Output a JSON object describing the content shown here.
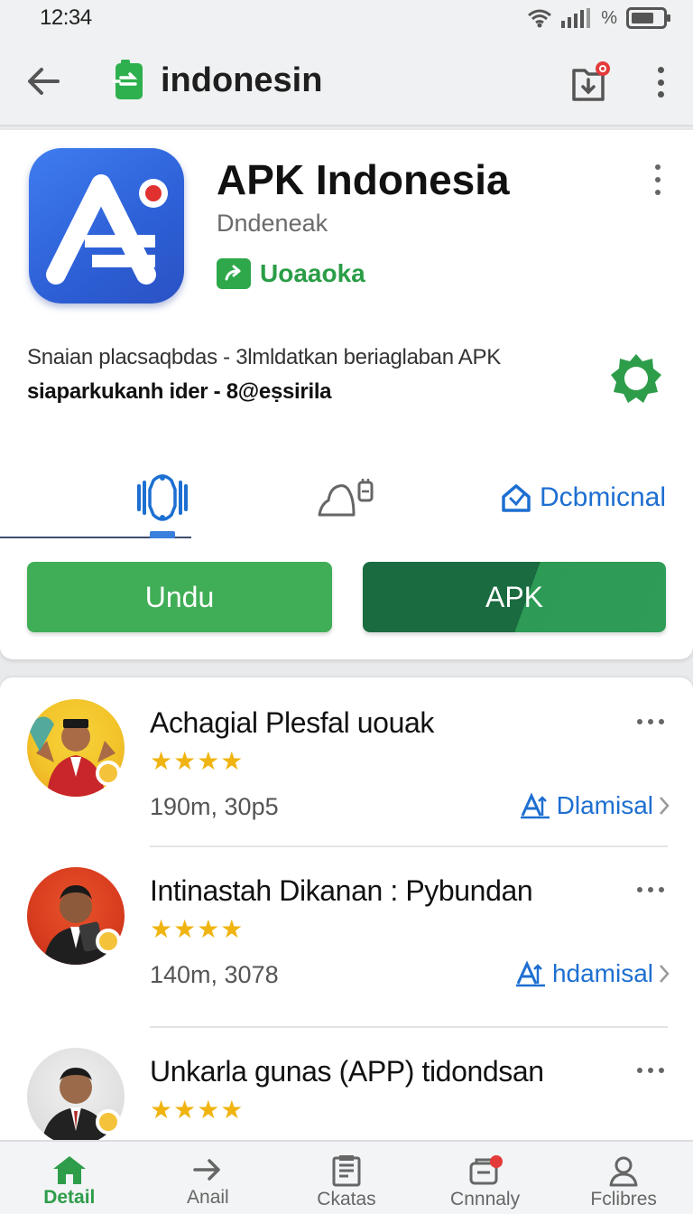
{
  "status_bar": {
    "time": "12:34",
    "battery_text": "%"
  },
  "app_bar": {
    "title": "indonesin"
  },
  "app": {
    "name": "APK Indonesia",
    "developer": "Dndeneak",
    "badge": "Uoaaoka",
    "description_line1": "Snaian placsaqbdas - 3lmldatkan beriaglaban APK",
    "description_line2": "siaparkukanh ider - 8@eṣsirila"
  },
  "tabs": [
    {
      "label": "",
      "icon": "bracket-icon",
      "active": true
    },
    {
      "label": "",
      "icon": "bell-icon",
      "active": false
    },
    {
      "label": "Dcbmicnal",
      "icon": "home-icon",
      "active": false
    }
  ],
  "buttons": {
    "primary": "Undu",
    "secondary": "APK"
  },
  "list": [
    {
      "title": "Achagial Plesfal uouak",
      "rating": 4,
      "stars": "★★★★",
      "meta": "190m, 30p5",
      "action": "Dlamisal"
    },
    {
      "title": "Intinastah Dikanan : Pybundan",
      "rating": 4,
      "stars": "★★★★",
      "meta": "140m, 3078",
      "action": "hdamisal"
    },
    {
      "title": "Unkarla gunas (APP) tidondsan",
      "rating": 4,
      "stars": "★★★★",
      "meta": "",
      "action": ""
    }
  ],
  "bottom_nav": [
    {
      "label": "Detail",
      "icon": "home-icon",
      "active": true
    },
    {
      "label": "Anail",
      "icon": "arrow-right-icon",
      "active": false
    },
    {
      "label": "Ckatas",
      "icon": "list-icon",
      "active": false
    },
    {
      "label": "Cnnnaly",
      "icon": "card-icon",
      "active": false
    },
    {
      "label": "Fclibres",
      "icon": "person-icon",
      "active": false
    }
  ],
  "colors": {
    "accent_green": "#3fae56",
    "dark_green": "#1a6b40",
    "link_blue": "#1d6fd1",
    "star": "#f0b411",
    "icon_blue": "#3f7df0"
  }
}
